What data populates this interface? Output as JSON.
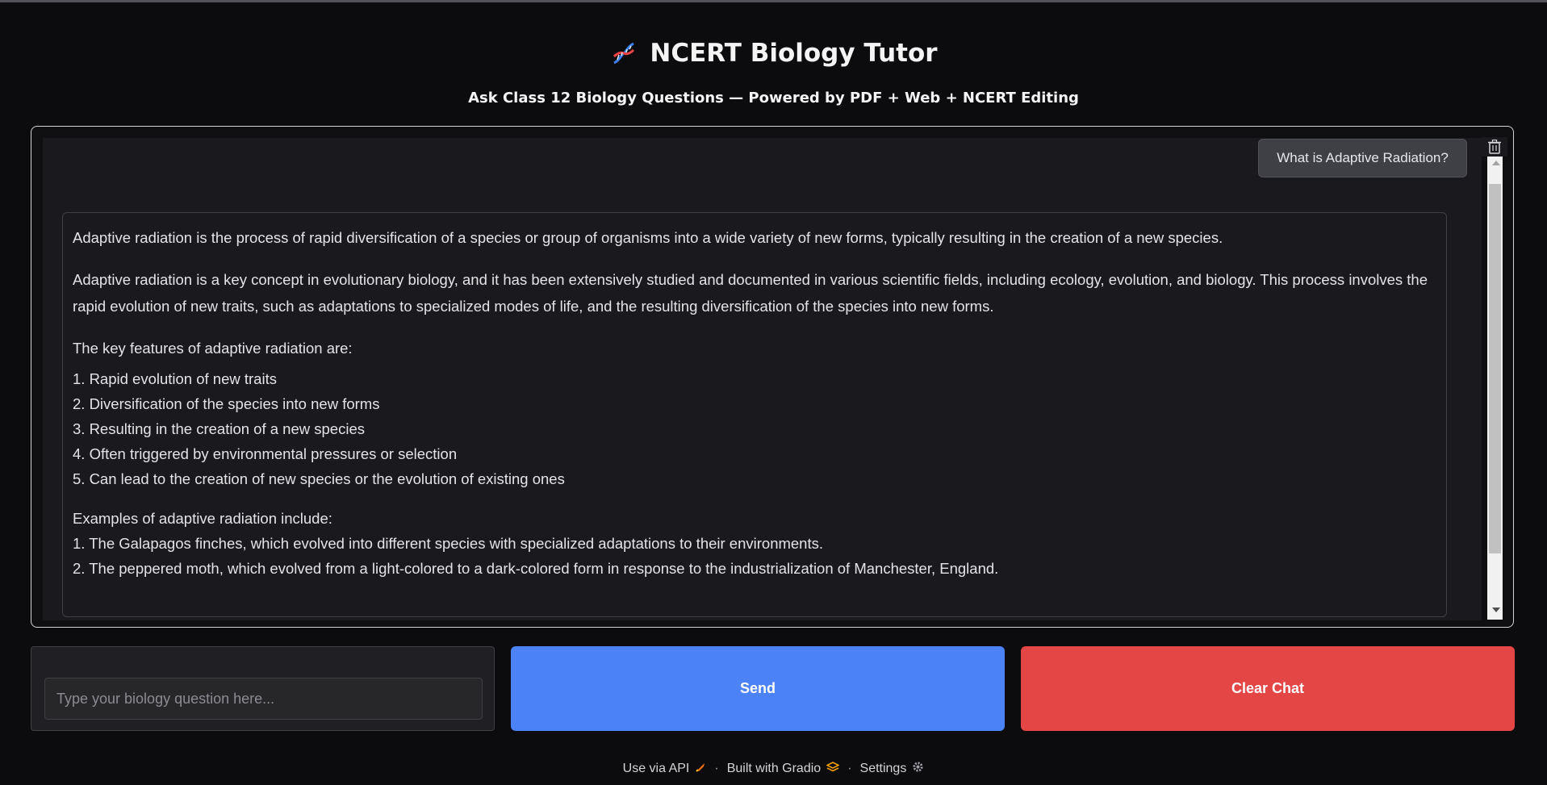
{
  "header": {
    "title": "NCERT Biology Tutor",
    "title_icon": "dna-icon",
    "subtitle": "Ask Class 12 Biology Questions — Powered by PDF + Web + NCERT Editing"
  },
  "chat": {
    "user_message": "What is Adaptive Radiation?",
    "bot_message": {
      "p1": "Adaptive radiation is the process of rapid diversification of a species or group of organisms into a wide variety of new forms, typically resulting in the creation of a new species.",
      "p2": "Adaptive radiation is a key concept in evolutionary biology, and it has been extensively studied and documented in various scientific fields, including ecology, evolution, and biology. This process involves the rapid evolution of new traits, such as adaptations to specialized modes of life, and the resulting diversification of the species into new forms.",
      "features_heading": "The key features of adaptive radiation are:",
      "features": [
        "1. Rapid evolution of new traits",
        "2. Diversification of the species into new forms",
        "3. Resulting in the creation of a new species",
        "4. Often triggered by environmental pressures or selection",
        "5. Can lead to the creation of new species or the evolution of existing ones"
      ],
      "examples_heading": "Examples of adaptive radiation include:",
      "examples": [
        "1. The Galapagos finches, which evolved into different species with specialized adaptations to their environments.",
        "2. The peppered moth, which evolved from a light-colored to a dark-colored form in response to the industrialization of Manchester, England."
      ]
    }
  },
  "input": {
    "placeholder": "Type your biology question here...",
    "value": ""
  },
  "buttons": {
    "send": "Send",
    "clear": "Clear Chat"
  },
  "footer": {
    "api": "Use via API",
    "built": "Built with Gradio",
    "settings": "Settings",
    "separator": "·"
  },
  "colors": {
    "send": "#4b82f5",
    "clear": "#e44646",
    "background": "#0c0c0f"
  }
}
